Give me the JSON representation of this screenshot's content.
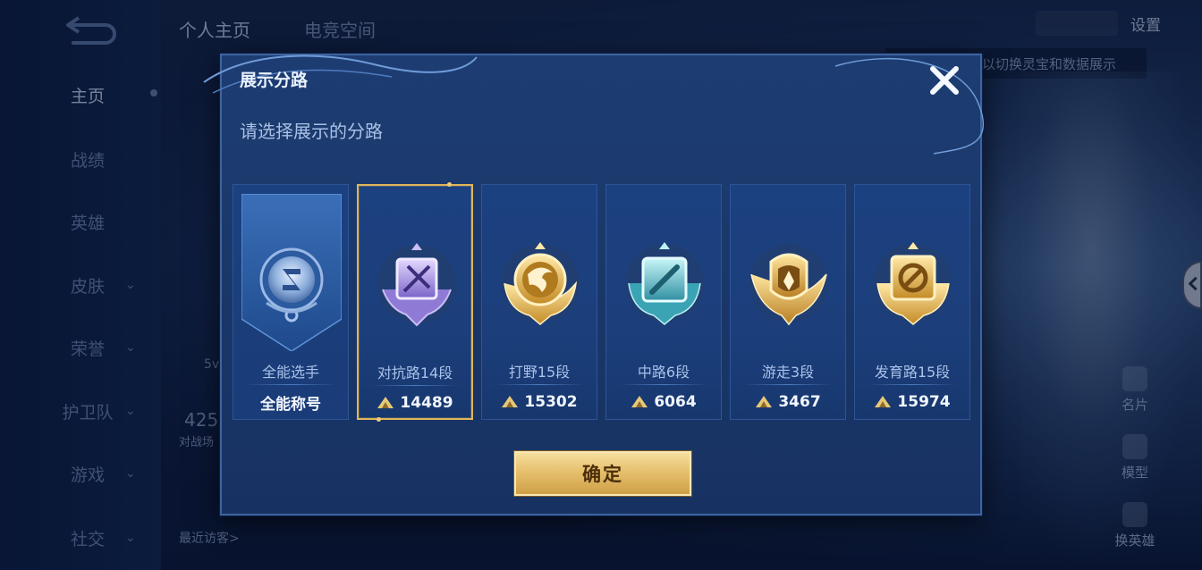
{
  "nav": {
    "items": [
      {
        "label": "主页",
        "has_chevron": false
      },
      {
        "label": "战绩",
        "has_chevron": false
      },
      {
        "label": "英雄",
        "has_chevron": false
      },
      {
        "label": "皮肤",
        "has_chevron": true
      },
      {
        "label": "荣誉",
        "has_chevron": true
      },
      {
        "label": "护卫队",
        "has_chevron": true
      },
      {
        "label": "游戏",
        "has_chevron": true
      },
      {
        "label": "社交",
        "has_chevron": true
      }
    ]
  },
  "tabs": [
    "个人主页",
    "电竞空间"
  ],
  "header": {
    "settings_label": "设置"
  },
  "hint": {
    "text": "以切换灵宝和数据展示"
  },
  "background": {
    "recent_visitors": "最近访客>",
    "battles_number": "425",
    "battles_label": "对战场",
    "win_label": "5v",
    "side_buttons": [
      "名片",
      "模型",
      "换英雄"
    ]
  },
  "modal": {
    "title": "展示分路",
    "subtitle": "请选择展示的分路",
    "confirm_label": "确定",
    "cards": [
      {
        "role": "全能选手",
        "score": "全能称号",
        "emblem": "all-round-icon",
        "selected": false
      },
      {
        "role": "对抗路14段",
        "score": "14489",
        "emblem": "clash-lane-icon",
        "selected": true
      },
      {
        "role": "打野15段",
        "score": "15302",
        "emblem": "jungle-icon",
        "selected": false
      },
      {
        "role": "中路6段",
        "score": "6064",
        "emblem": "mid-lane-icon",
        "selected": false
      },
      {
        "role": "游走3段",
        "score": "3467",
        "emblem": "roam-icon",
        "selected": false
      },
      {
        "role": "发育路15段",
        "score": "15974",
        "emblem": "farm-lane-icon",
        "selected": false
      }
    ]
  },
  "colors": {
    "accent_gold": "#e0b55a",
    "modal_bg": "#1b3a6e",
    "text_light": "#e9f1ff"
  }
}
